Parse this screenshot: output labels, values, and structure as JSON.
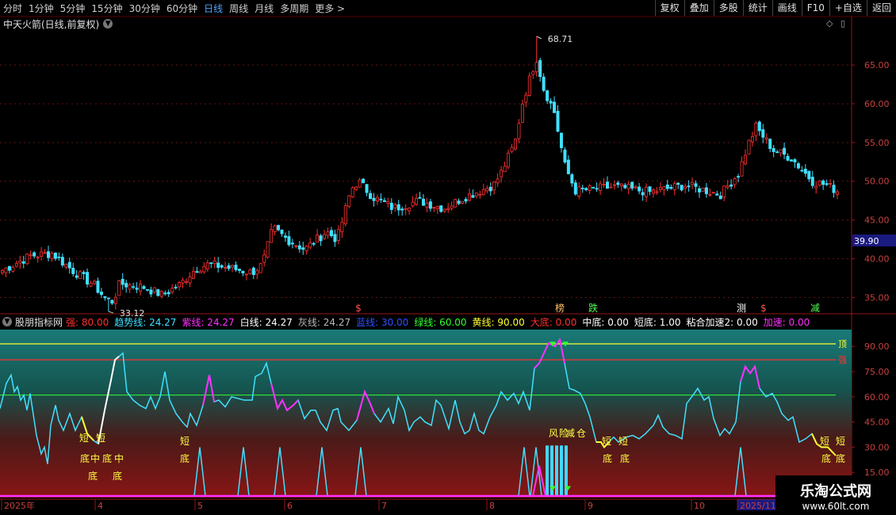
{
  "toolbar": {
    "timeframes": [
      "分时",
      "1分钟",
      "5分钟",
      "15分钟",
      "30分钟",
      "60分钟",
      "日线",
      "周线",
      "月线",
      "多周期",
      "更多 >"
    ],
    "active": "日线",
    "right_buttons": [
      "复权",
      "叠加",
      "多股",
      "统计",
      "画线",
      "F10",
      "+自选",
      "返回"
    ]
  },
  "main_chart": {
    "title": "中天火箭(日线,前复权)",
    "price_axis": [
      65,
      60,
      55,
      50,
      45,
      40,
      35
    ],
    "price_axis_labels": [
      "65.00",
      "60.00",
      "55.00",
      "50.00",
      "45.00",
      "40.00",
      "35.00"
    ],
    "current_price": "39.90",
    "high_label": "68.71",
    "low_label": "33.12",
    "signals": [
      {
        "text": "$",
        "color": "#ff5050"
      },
      {
        "text": "榜",
        "color": "#ffc060"
      },
      {
        "text": "跌",
        "color": "#50ff50"
      },
      {
        "text": "测",
        "color": "#ffffff"
      },
      {
        "text": "$",
        "color": "#ff5050"
      },
      {
        "text": "减",
        "color": "#50ff50"
      }
    ]
  },
  "indicator": {
    "name": "股朋指标网",
    "legend": [
      {
        "label": "强: 80.00",
        "color": "#ff3030"
      },
      {
        "label": "趋势线: 24.27",
        "color": "#40e0ff"
      },
      {
        "label": "紫线: 24.27",
        "color": "#ff30ff"
      },
      {
        "label": "白线: 24.27",
        "color": "#ffffff"
      },
      {
        "label": "灰线: 24.27",
        "color": "#bbbbbb"
      },
      {
        "label": "蓝线: 30.00",
        "color": "#3050ff"
      },
      {
        "label": "绿线: 60.00",
        "color": "#30ff30"
      },
      {
        "label": "黄线: 90.00",
        "color": "#ffff30"
      },
      {
        "label": "大底: 0.00",
        "color": "#ff3030"
      },
      {
        "label": "中底: 0.00",
        "color": "#ffffff"
      },
      {
        "label": "短底: 1.00",
        "color": "#ffffff"
      },
      {
        "label": "粘合加速2: 0.00",
        "color": "#ffffff"
      },
      {
        "label": "加速: 0.00",
        "color": "#ff30ff"
      }
    ],
    "axis": [
      90,
      75,
      60,
      45,
      30,
      15
    ],
    "axis_labels": [
      "90.00",
      "75.00",
      "60.00",
      "45.00",
      "30.00",
      "15.00"
    ],
    "line_labels": {
      "top": "顶",
      "strong": "强"
    },
    "annotations": [
      "短",
      "底",
      "中",
      "短",
      "底",
      "中",
      "底",
      "底",
      "短",
      "底",
      "风",
      "险",
      "减",
      "仓",
      "短",
      "底",
      "短",
      "底",
      "短",
      "底",
      "短",
      "底"
    ]
  },
  "xaxis": [
    {
      "label": "2025年"
    },
    {
      "label": "4"
    },
    {
      "label": "5"
    },
    {
      "label": "6"
    },
    {
      "label": "7"
    },
    {
      "label": "8"
    },
    {
      "label": "9"
    },
    {
      "label": "10"
    },
    {
      "label": "2025/11/"
    }
  ],
  "watermark": {
    "title": "乐淘公式网",
    "url": "www.60lt.com"
  },
  "colors": {
    "up": "#ff3030",
    "down": "#40e0ff",
    "grid": "#661010",
    "strong": "#ff3030",
    "top": "#ffff30",
    "green": "#30ff30",
    "purple": "#ff30ff",
    "cyan": "#40e0ff"
  },
  "chart_data": {
    "type": "candlestick",
    "ylim": [
      33,
      69
    ],
    "indicator_ylim": [
      0,
      100
    ]
  }
}
